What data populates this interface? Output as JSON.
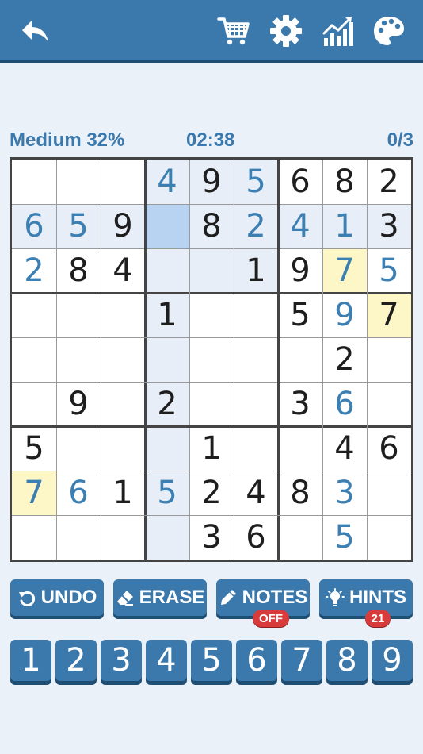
{
  "header": {
    "icons": [
      "back-arrow-icon",
      "shopping-cart-icon",
      "gear-icon",
      "stats-chart-icon",
      "palette-icon"
    ]
  },
  "status": {
    "difficulty": "Medium 32%",
    "timer": "02:38",
    "mistakes": "0/3"
  },
  "board": {
    "rows": [
      [
        "",
        "",
        "",
        "4",
        "9",
        "5",
        "6",
        "8",
        "2"
      ],
      [
        "6",
        "5",
        "9",
        "",
        "8",
        "2",
        "4",
        "1",
        "3"
      ],
      [
        "2",
        "8",
        "4",
        "",
        "",
        "1",
        "9",
        "7",
        "5"
      ],
      [
        "",
        "",
        "",
        "1",
        "",
        "",
        "5",
        "9",
        "7"
      ],
      [
        "",
        "",
        "",
        "",
        "",
        "",
        "",
        "2",
        ""
      ],
      [
        "",
        "9",
        "",
        "2",
        "",
        "",
        "3",
        "6",
        ""
      ],
      [
        "5",
        "",
        "",
        "",
        "1",
        "",
        "",
        "4",
        "6"
      ],
      [
        "7",
        "6",
        "1",
        "5",
        "2",
        "4",
        "8",
        "3",
        ""
      ],
      [
        "",
        "",
        "",
        "",
        "3",
        "6",
        "",
        "5",
        ""
      ]
    ],
    "user_entered": [
      [
        0,
        3
      ],
      [
        0,
        5
      ],
      [
        1,
        0
      ],
      [
        1,
        1
      ],
      [
        1,
        5
      ],
      [
        1,
        6
      ],
      [
        1,
        7
      ],
      [
        2,
        0
      ],
      [
        2,
        7
      ],
      [
        2,
        8
      ],
      [
        3,
        7
      ],
      [
        5,
        7
      ],
      [
        7,
        0
      ],
      [
        7,
        1
      ],
      [
        7,
        3
      ],
      [
        7,
        7
      ],
      [
        8,
        7
      ]
    ],
    "selected": [
      1,
      3
    ],
    "conflict": [
      [
        2,
        7
      ],
      [
        3,
        8
      ],
      [
        7,
        0
      ]
    ],
    "colors": {
      "given": "#1e1e1e",
      "user": "#3c7fb2",
      "highlight": "#e7eef8",
      "selected": "#b8d3f1",
      "conflict": "#fdf6c6",
      "accent": "#3b79ad"
    }
  },
  "tools": {
    "undo": "UNDO",
    "erase": "ERASE",
    "notes": "NOTES",
    "notes_state": "OFF",
    "hints": "HINTS",
    "hints_count": "21"
  },
  "numpad": [
    "1",
    "2",
    "3",
    "4",
    "5",
    "6",
    "7",
    "8",
    "9"
  ]
}
